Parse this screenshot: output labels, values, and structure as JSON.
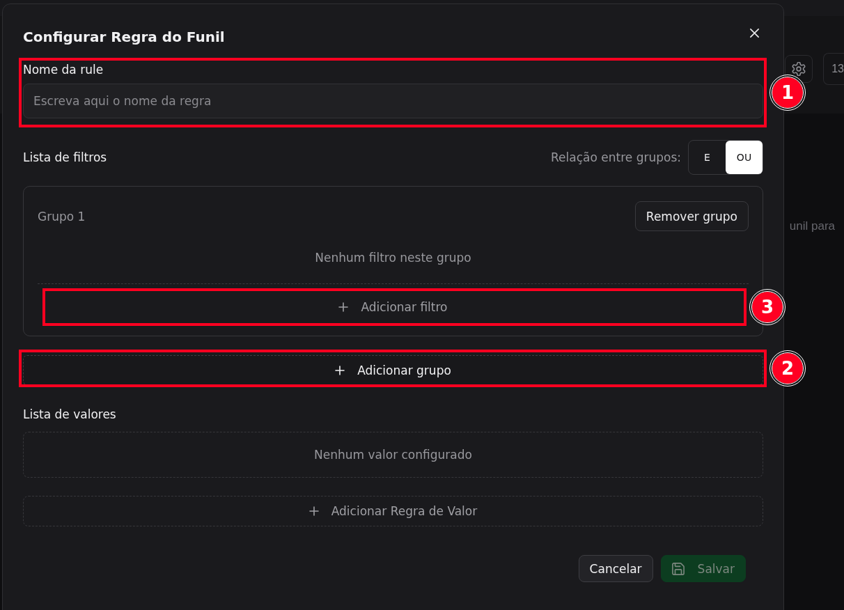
{
  "background": {
    "toolbar_value": "13",
    "content_text": "unil para"
  },
  "dialog": {
    "title": "Configurar Regra do Funil",
    "name_field": {
      "label": "Nome da rule",
      "placeholder": "Escreva aqui o nome da regra",
      "callout": "1"
    },
    "filters": {
      "title": "Lista de filtros",
      "relation_label": "Relação entre grupos:",
      "relation_options": [
        {
          "label": "E",
          "selected": false
        },
        {
          "label": "OU",
          "selected": true
        }
      ],
      "groups": [
        {
          "title": "Grupo 1",
          "remove_button": "Remover grupo",
          "empty_text": "Nenhum filtro neste grupo",
          "add_filter_button": {
            "label": "Adicionar filtro",
            "callout": "3"
          }
        }
      ],
      "add_group_button": {
        "label": "Adicionar grupo",
        "callout": "2"
      }
    },
    "values": {
      "title": "Lista de valores",
      "empty_text": "Nenhum valor configurado",
      "add_button": "Adicionar Regra de Valor"
    },
    "footer_buttons": [
      {
        "label": "Cancelar",
        "kind": "secondary",
        "disabled": false
      },
      {
        "label": "Salvar",
        "kind": "primary",
        "disabled": true
      }
    ]
  }
}
